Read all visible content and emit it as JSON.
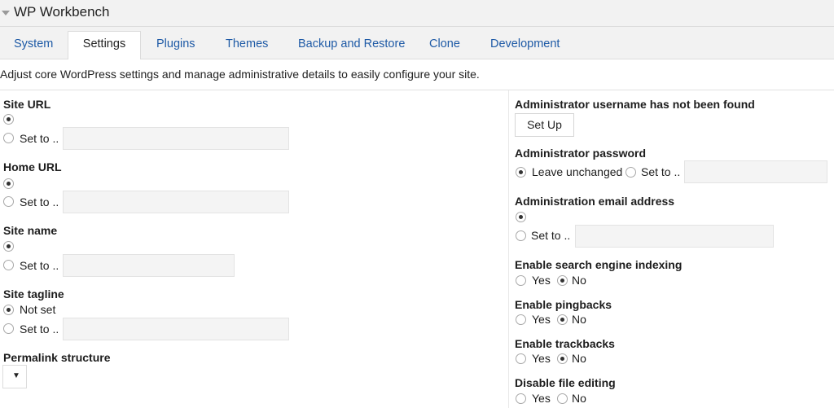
{
  "app": {
    "title": "WP Workbench"
  },
  "tabs": [
    "System",
    "Settings",
    "Plugins",
    "Themes",
    "Backup and Restore",
    "Clone",
    "Development"
  ],
  "description": "Adjust core WordPress settings and manage administrative details to easily configure your site.",
  "left": {
    "site_url": {
      "label": "Site URL",
      "set_to": "Set to .."
    },
    "home_url": {
      "label": "Home URL",
      "set_to": "Set to .."
    },
    "site_name": {
      "label": "Site name",
      "set_to": "Set to .."
    },
    "site_tagline": {
      "label": "Site tagline",
      "not_set": "Not set",
      "set_to": "Set to .."
    },
    "permalink": {
      "label": "Permalink structure",
      "selected": ""
    }
  },
  "right": {
    "admin_username": {
      "label": "Administrator username has not been found",
      "button": "Set Up"
    },
    "admin_password": {
      "label": "Administrator password",
      "leave_unchanged": "Leave unchanged",
      "set_to": "Set to .."
    },
    "admin_email": {
      "label": "Administration email address",
      "set_to": "Set to .."
    },
    "search_indexing": {
      "label": "Enable search engine indexing",
      "yes": "Yes",
      "no": "No",
      "value": "No"
    },
    "pingbacks": {
      "label": "Enable pingbacks",
      "yes": "Yes",
      "no": "No",
      "value": "No"
    },
    "trackbacks": {
      "label": "Enable trackbacks",
      "yes": "Yes",
      "no": "No",
      "value": "No"
    },
    "file_editing": {
      "label": "Disable file editing",
      "yes": "Yes",
      "no": "No",
      "value": ""
    }
  }
}
